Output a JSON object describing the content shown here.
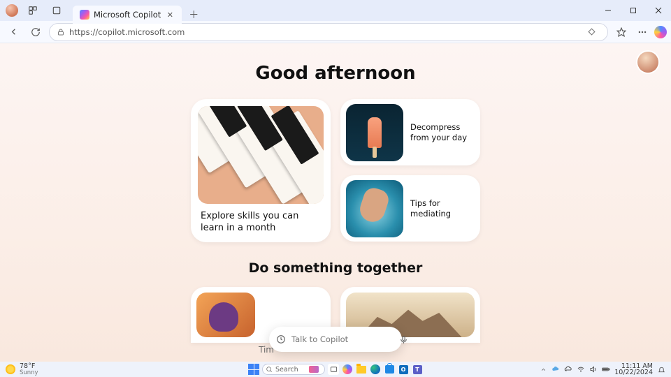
{
  "browser": {
    "tab_title": "Microsoft Copilot",
    "url": "https://copilot.microsoft.com",
    "favorites_star_label": "Add to favorites"
  },
  "page": {
    "greeting": "Good afternoon",
    "big_card_label": "Explore skills you can learn in a month",
    "small_card_1": "Decompress from your day",
    "small_card_2": "Tips for mediating",
    "subheading": "Do something together",
    "truncated_label": "Tim",
    "compose_placeholder": "Talk to Copilot"
  },
  "taskbar": {
    "temp": "78°F",
    "condition": "Sunny",
    "search_placeholder": "Search",
    "time": "11:11 AM",
    "date": "10/22/2024"
  }
}
